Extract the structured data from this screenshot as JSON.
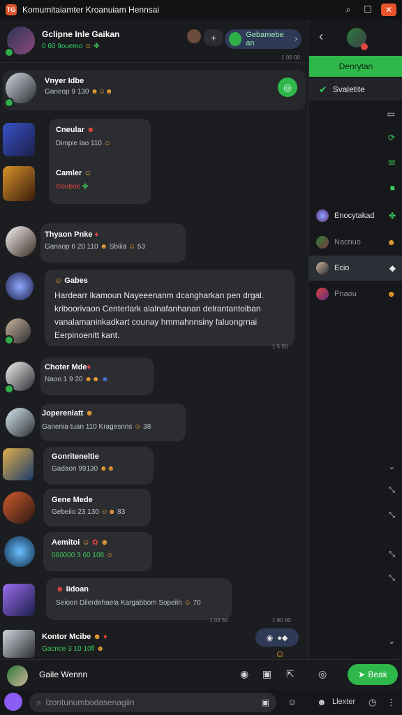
{
  "window": {
    "title": "Komumitaiamter Kroanuiam Hennsai",
    "logo": "TG"
  },
  "header": {
    "name": "Gclipne Inle Gaikan",
    "status": "0 60 9ouemo",
    "call_label": "Gebamebe an",
    "time": "1 00 00"
  },
  "messages": [
    {
      "name": "Vnyer Idbe",
      "meta": "Ganeop 9 130"
    },
    {
      "name": "Cneular",
      "meta": "Dimpie lao 110"
    },
    {
      "name": "Camler",
      "meta": "©ouboe"
    },
    {
      "name": "Thyaon Pnke",
      "meta": "Ganaop 6 20 110",
      "extra": "Sbiiia",
      "extra2": "53"
    },
    {
      "name": "Gabes",
      "text": "Hardearr lkamoun Nayeeenanm dcangharkan pen drgal. kriboorivaon Centerlark alalnafanhanan delrantantoiban vanalamaninkadkart counay hmmahnnsiny faluongrnai Eerpinoenitt kant.",
      "time": "1 5 50"
    },
    {
      "name": "Choter Mde",
      "meta": "Naoo 1 9 20"
    },
    {
      "name": "Joperenlatt",
      "meta": "Ganenia tuan 110 Kragesnns",
      "extra": "38"
    },
    {
      "name": "Gonriteneltie",
      "meta": "Gadaon 99130"
    },
    {
      "name": "Gene Mede",
      "meta": "Gebeiio 23 130",
      "extra": "83"
    },
    {
      "name": "Aemitoi",
      "meta": "060000 3 60 108"
    },
    {
      "name": "Iidoan",
      "meta": "Seioon Dilerdehaela Kargabbom Sopeiln",
      "extra": "70",
      "time": "1 03 50",
      "time2": "1 90 90"
    },
    {
      "name": "Kontor Mcibe",
      "meta": "Gacnce 3 10 10fl"
    }
  ],
  "sidebar": {
    "primary_button": "Denrytan",
    "checked_item": "Svaletite",
    "rows": [
      {
        "label": "Enocytakad"
      },
      {
        "label": "Nacnuo"
      },
      {
        "label": "Ecio"
      },
      {
        "label": "Pnaou"
      }
    ]
  },
  "footer": {
    "user": "Gaile Wennn",
    "send_label": "Beak",
    "search_placeholder": "Izontunumbodasenagiin",
    "label_b": "Llexter"
  },
  "colors": {
    "accent": "#2fb84a",
    "close": "#e8552c",
    "bubble": "#2b2d31"
  }
}
